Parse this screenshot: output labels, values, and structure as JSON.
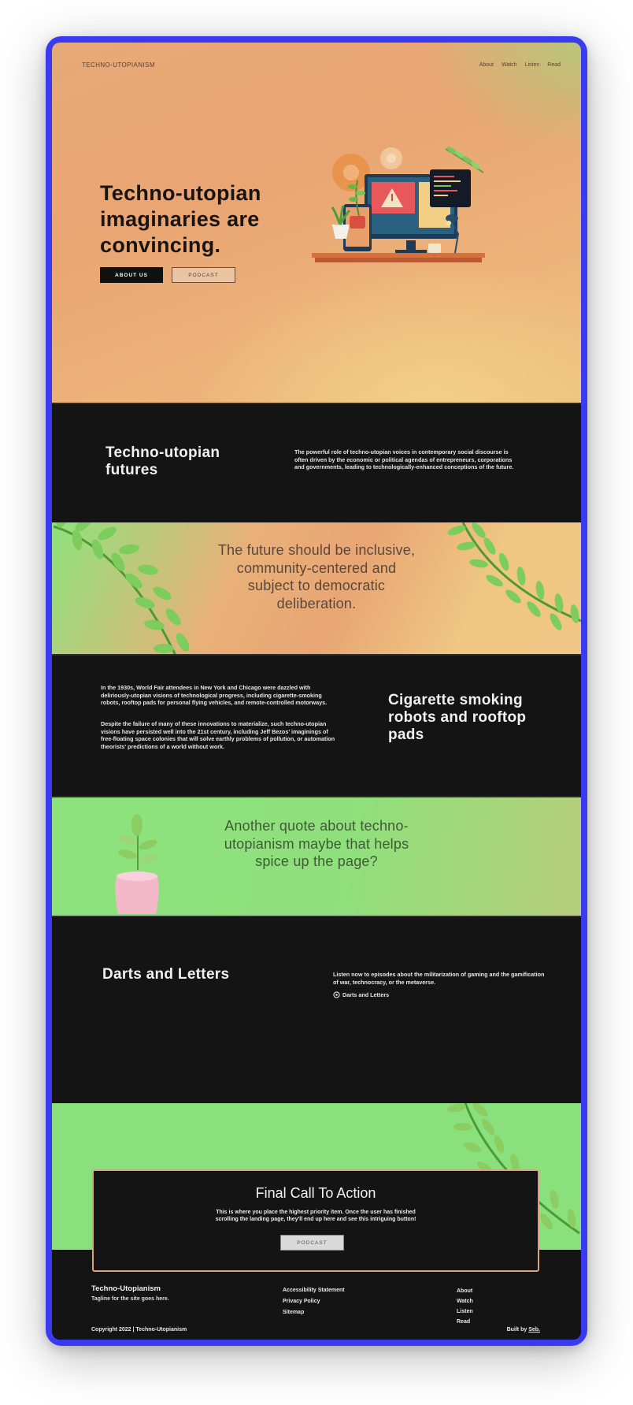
{
  "site": {
    "brand": "TECHNO-UTOPIANISM"
  },
  "nav": [
    "About",
    "Watch",
    "Listen",
    "Read"
  ],
  "hero": {
    "title_lines": [
      "Techno-utopian",
      "imaginaries are",
      "convincing."
    ],
    "primary_button": "ABOUT US",
    "secondary_button": "PODCAST"
  },
  "futures": {
    "title_lines": [
      "Techno-utopian",
      "futures"
    ],
    "body": "The powerful role of techno-utopian voices in contemporary social discourse is often driven by the economic or political agendas of entrepreneurs, corporations and governments, leading to technologically-enhanced conceptions of the future."
  },
  "quote1": {
    "lines": [
      "The future should be inclusive,",
      "community-centered and",
      "subject to democratic",
      "deliberation."
    ]
  },
  "history": {
    "paragraph1": "In the 1930s, World Fair attendees in New York and Chicago were dazzled with deliriously-utopian visions of technological progress, including cigarette-smoking robots, rooftop pads for personal flying vehicles, and remote-controlled motorways.",
    "paragraph2": "Despite the failure of many of these innovations to materialize, such techno-utopian visions have persisted well into the 21st century, including Jeff Bezos' imaginings of free-floating space colonies that will solve earthly problems of pollution, or automation theorists' predictions of a world without work.",
    "title_lines": [
      "Cigarette smoking",
      "robots and rooftop",
      "pads"
    ]
  },
  "quote2": {
    "lines": [
      "Another quote about techno-",
      "utopianism maybe that helps",
      "spice up the page?"
    ]
  },
  "podcast": {
    "title": "Darts and Letters",
    "body": "Listen now to episodes about the militarization of gaming and the gamification of war, technocracy, or the metaverse.",
    "link": "Darts and Letters"
  },
  "cta": {
    "title": "Final Call To Action",
    "body_lines": [
      "This is where you place the highest priority item. Once the user has finished",
      "scrolling the landing page, they'll end up here and see this intriguing button!"
    ],
    "button": "PODCAST"
  },
  "footer": {
    "brand": "Techno-Utopianism",
    "tagline": "Tagline for the site goes here.",
    "legal_links": [
      "Accessibility Statement",
      "Privacy Policy",
      "Sitemap"
    ],
    "nav_links": [
      "About",
      "Watch",
      "Listen",
      "Read"
    ],
    "copyright": "Copyright 2022 | Techno-Utopianism",
    "built_by_prefix": "Built by ",
    "built_by_name": "Seb."
  },
  "colors": {
    "frame": "#3a3af0",
    "dark": "#141414",
    "green": "#89e07d",
    "peach": "#e9a673",
    "cta_border": "#d7a27d"
  },
  "icons": [
    "headphones-icon",
    "leaf-branch-icon",
    "plant-pot-icon",
    "computer-illustration-icon"
  ]
}
